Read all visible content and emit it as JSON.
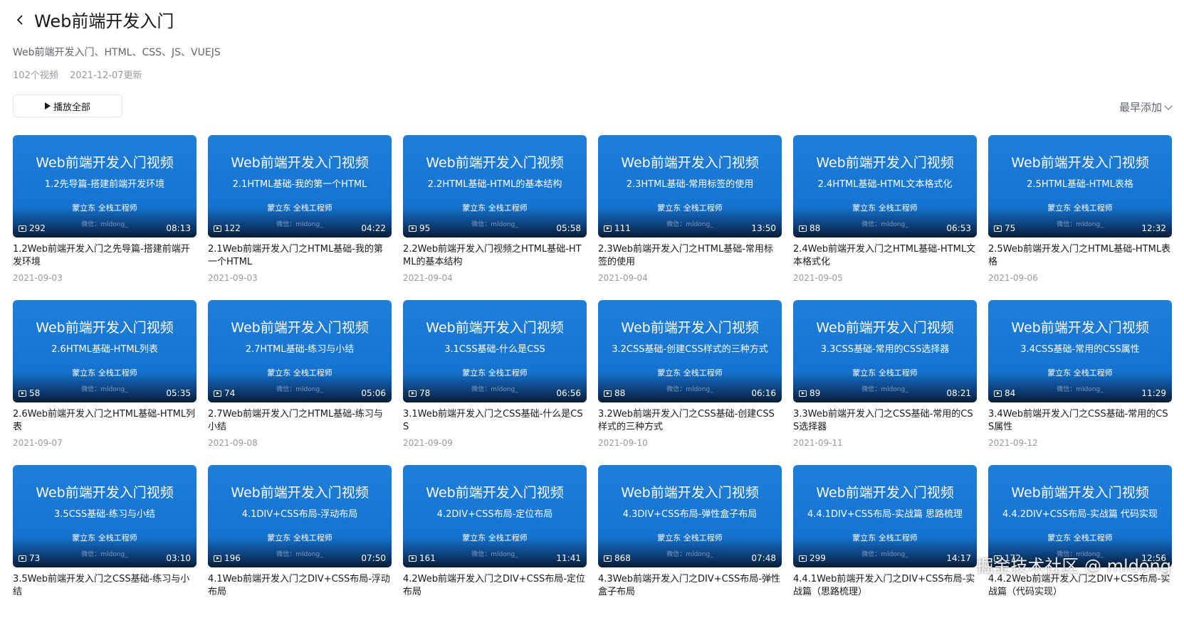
{
  "header": {
    "title": "Web前端开发入门"
  },
  "description": "Web前端开发入门、HTML、CSS、JS、VUEJS",
  "meta": {
    "count": "102个视频",
    "updated": "2021-12-07更新"
  },
  "toolbar": {
    "play_all": "播放全部",
    "sort": "最早添加"
  },
  "watermark": "掘金技术社区 @ mldong",
  "thumb_common": {
    "main": "Web前端开发入门视频",
    "author": "蒙立东 全栈工程师",
    "wechat": "微信：mldong_"
  },
  "videos": [
    {
      "sub": "1.2先导篇-搭建前端开发环境",
      "views": "292",
      "duration": "08:13",
      "title": "1.2Web前端开发入门之先导篇-搭建前端开发环境",
      "date": "2021-09-03"
    },
    {
      "sub": "2.1HTML基础-我的第一个HTML",
      "views": "122",
      "duration": "04:22",
      "title": "2.1Web前端开发入门之HTML基础-我的第一个HTML",
      "date": "2021-09-03"
    },
    {
      "sub": "2.2HTML基础-HTML的基本结构",
      "views": "95",
      "duration": "05:58",
      "title": "2.2Web前端开发入门视频之HTML基础-HTML的基本结构",
      "date": "2021-09-04"
    },
    {
      "sub": "2.3HTML基础-常用标签的使用",
      "views": "111",
      "duration": "13:50",
      "title": "2.3Web前端开发入门之HTML基础-常用标签的使用",
      "date": "2021-09-04"
    },
    {
      "sub": "2.4HTML基础-HTML文本格式化",
      "views": "88",
      "duration": "06:53",
      "title": "2.4Web前端开发入门之HTML基础-HTML文本格式化",
      "date": "2021-09-05"
    },
    {
      "sub": "2.5HTML基础-HTML表格",
      "views": "75",
      "duration": "12:32",
      "title": "2.5Web前端开发入门之HTML基础-HTML表格",
      "date": "2021-09-06"
    },
    {
      "sub": "2.6HTML基础-HTML列表",
      "views": "58",
      "duration": "05:35",
      "title": "2.6Web前端开发入门之HTML基础-HTML列表",
      "date": "2021-09-07"
    },
    {
      "sub": "2.7HTML基础-练习与小结",
      "views": "74",
      "duration": "05:06",
      "title": "2.7Web前端开发入门之HTML基础-练习与小结",
      "date": "2021-09-08"
    },
    {
      "sub": "3.1CSS基础-什么是CSS",
      "views": "78",
      "duration": "06:56",
      "title": "3.1Web前端开发入门之CSS基础-什么是CSS",
      "date": "2021-09-09"
    },
    {
      "sub": "3.2CSS基础-创建CSS样式的三种方式",
      "views": "88",
      "duration": "06:16",
      "title": "3.2Web前端开发入门之CSS基础-创建CSS样式的三种方式",
      "date": "2021-09-10"
    },
    {
      "sub": "3.3CSS基础-常用的CSS选择器",
      "views": "89",
      "duration": "08:21",
      "title": "3.3Web前端开发入门之CSS基础-常用的CSS选择器",
      "date": "2021-09-11"
    },
    {
      "sub": "3.4CSS基础-常用的CSS属性",
      "views": "84",
      "duration": "11:29",
      "title": "3.4Web前端开发入门之CSS基础-常用的CSS属性",
      "date": "2021-09-12"
    },
    {
      "sub": "3.5CSS基础-练习与小结",
      "views": "73",
      "duration": "03:10",
      "title": "3.5Web前端开发入门之CSS基础-练习与小结",
      "date": ""
    },
    {
      "sub": "4.1DIV+CSS布局-浮动布局",
      "views": "196",
      "duration": "07:50",
      "title": "4.1Web前端开发入门之DIV+CSS布局-浮动布局",
      "date": ""
    },
    {
      "sub": "4.2DIV+CSS布局-定位布局",
      "views": "161",
      "duration": "11:41",
      "title": "4.2Web前端开发入门之DIV+CSS布局-定位布局",
      "date": ""
    },
    {
      "sub": "4.3DIV+CSS布局-弹性盒子布局",
      "views": "868",
      "duration": "07:48",
      "title": "4.3Web前端开发入门之DIV+CSS布局-弹性盒子布局",
      "date": ""
    },
    {
      "sub": "4.4.1DIV+CSS布局-实战篇 思路梳理",
      "views": "299",
      "duration": "14:17",
      "title": "4.4.1Web前端开发入门之DIV+CSS布局-实战篇（思路梳理）",
      "date": ""
    },
    {
      "sub": "4.4.2DIV+CSS布局-实战篇 代码实现",
      "views": "172",
      "duration": "12:56",
      "title": "4.4.2Web前端开发入门之DIV+CSS布局-实战篇（代码实现）",
      "date": ""
    }
  ]
}
